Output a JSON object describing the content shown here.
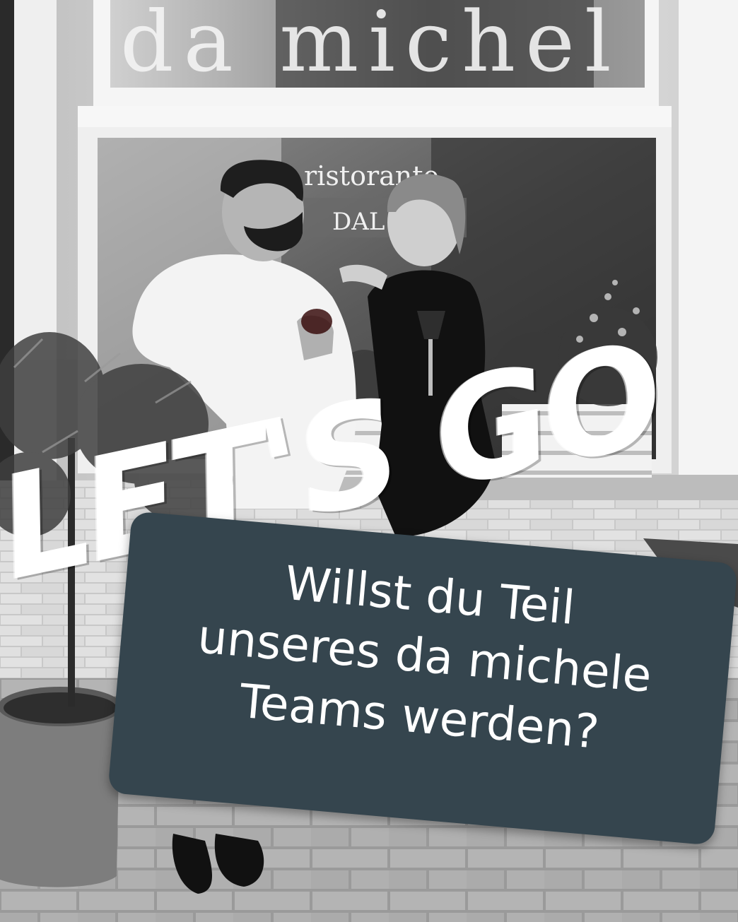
{
  "poster": {
    "overlay_text": "LET'S GO",
    "card_lines": [
      "Willst du Teil",
      "unseres da michele",
      "Teams werden?"
    ]
  },
  "storefront": {
    "sign_text": "da michel",
    "window_text_1": "ristorante",
    "window_text_2": "DAL 19"
  },
  "colors": {
    "card_background": "#35454e",
    "card_text": "#ffffff",
    "overlay_text": "#ffffff"
  }
}
